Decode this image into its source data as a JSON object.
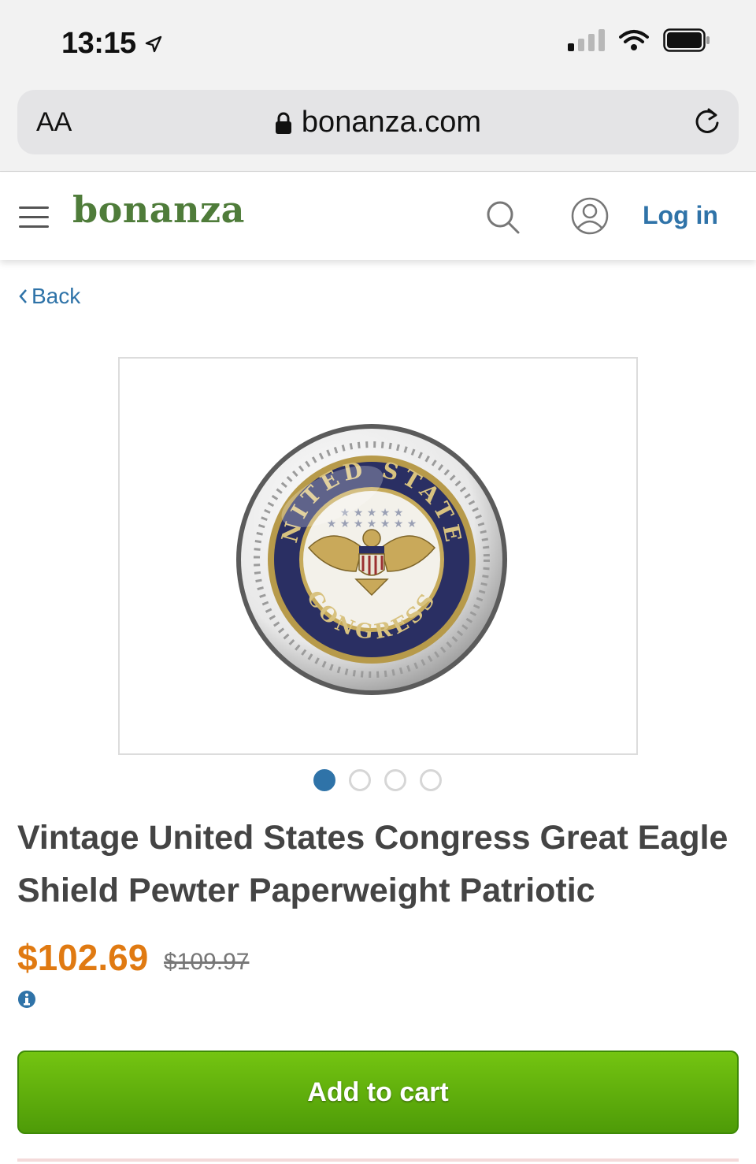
{
  "status_bar": {
    "time": "13:15"
  },
  "browser": {
    "text_size_label": "AA",
    "url": "bonanza.com"
  },
  "header": {
    "logo": "bonanza",
    "login_label": "Log in"
  },
  "nav": {
    "back_label": "Back"
  },
  "product": {
    "carousel_count": 4,
    "carousel_active_index": 0,
    "image_lettering": [
      "UNITED STATES",
      "CONGRESS"
    ],
    "title": "Vintage United States Congress Great Eagle Shield Pewter Paperweight Patriotic",
    "price": "$102.69",
    "original_price": "$109.97",
    "add_to_cart_label": "Add to cart"
  },
  "colors": {
    "brand_green": "#4f7c3a",
    "link_blue": "#2f73a8",
    "price_orange": "#e07a12",
    "cart_green": "#5fae0c"
  }
}
